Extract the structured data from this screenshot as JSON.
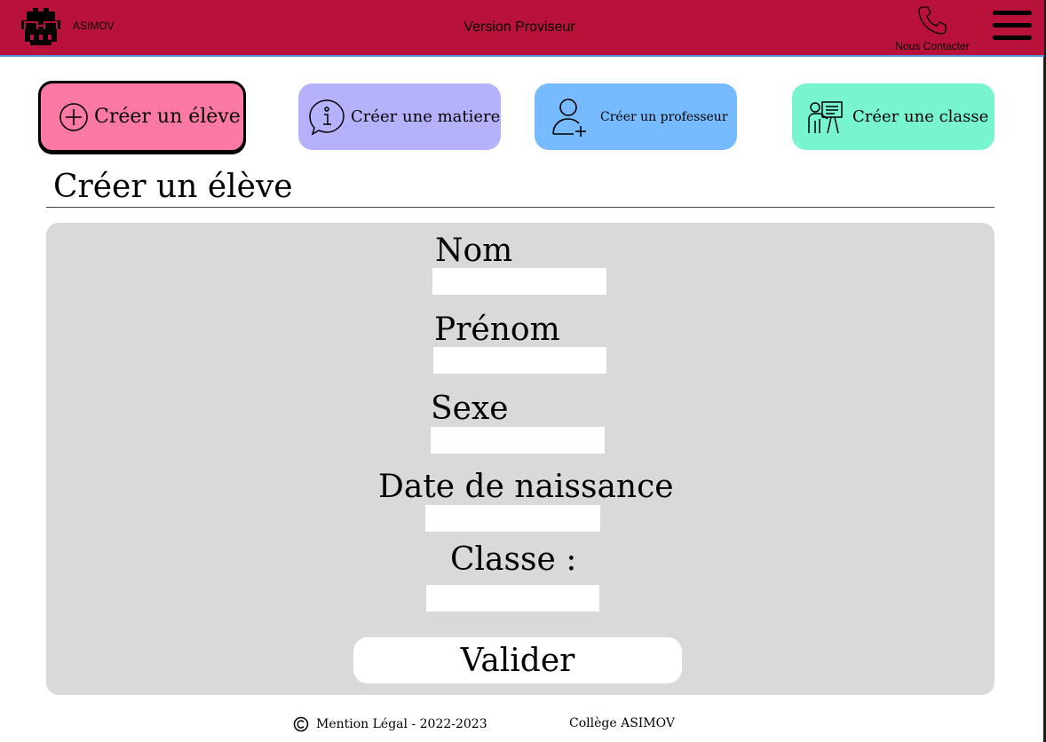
{
  "header": {
    "brand": "ASIMOV",
    "title": "Version Proviseur",
    "contact_label": "Nous Contacter",
    "icons": {
      "logo": "robot-logo-icon",
      "phone": "phone-icon",
      "menu": "hamburger-menu-icon"
    },
    "colors": {
      "background": "#b8123b",
      "underline": "#5b8fd8"
    }
  },
  "actions": [
    {
      "label": "Créer un élève",
      "icon": "plus-circle-icon",
      "color": "#fb79a4",
      "active": true
    },
    {
      "label": "Créer une matiere",
      "icon": "info-bubble-icon",
      "color": "#b6b1fb",
      "active": false
    },
    {
      "label": "Créer un professeur",
      "icon": "user-plus-icon",
      "color": "#76bbff",
      "active": false
    },
    {
      "label": "Créer une classe",
      "icon": "teacher-board-icon",
      "color": "#78f4d1",
      "active": false
    }
  ],
  "section": {
    "title": "Créer un élève"
  },
  "form": {
    "fields": [
      {
        "label": "Nom",
        "value": "",
        "placeholder": ""
      },
      {
        "label": "Prénom",
        "value": "",
        "placeholder": ""
      },
      {
        "label": "Sexe",
        "value": "",
        "placeholder": ""
      },
      {
        "label": "Date de naissance",
        "value": "",
        "placeholder": ""
      },
      {
        "label": "Classe :",
        "value": "",
        "placeholder": ""
      }
    ],
    "submit_label": "Valider",
    "panel_color": "#d9d9d9"
  },
  "footer": {
    "legal": "Mention Légal - 2022-2023",
    "school": "Collège ASIMOV",
    "icon": "copyright-icon"
  }
}
